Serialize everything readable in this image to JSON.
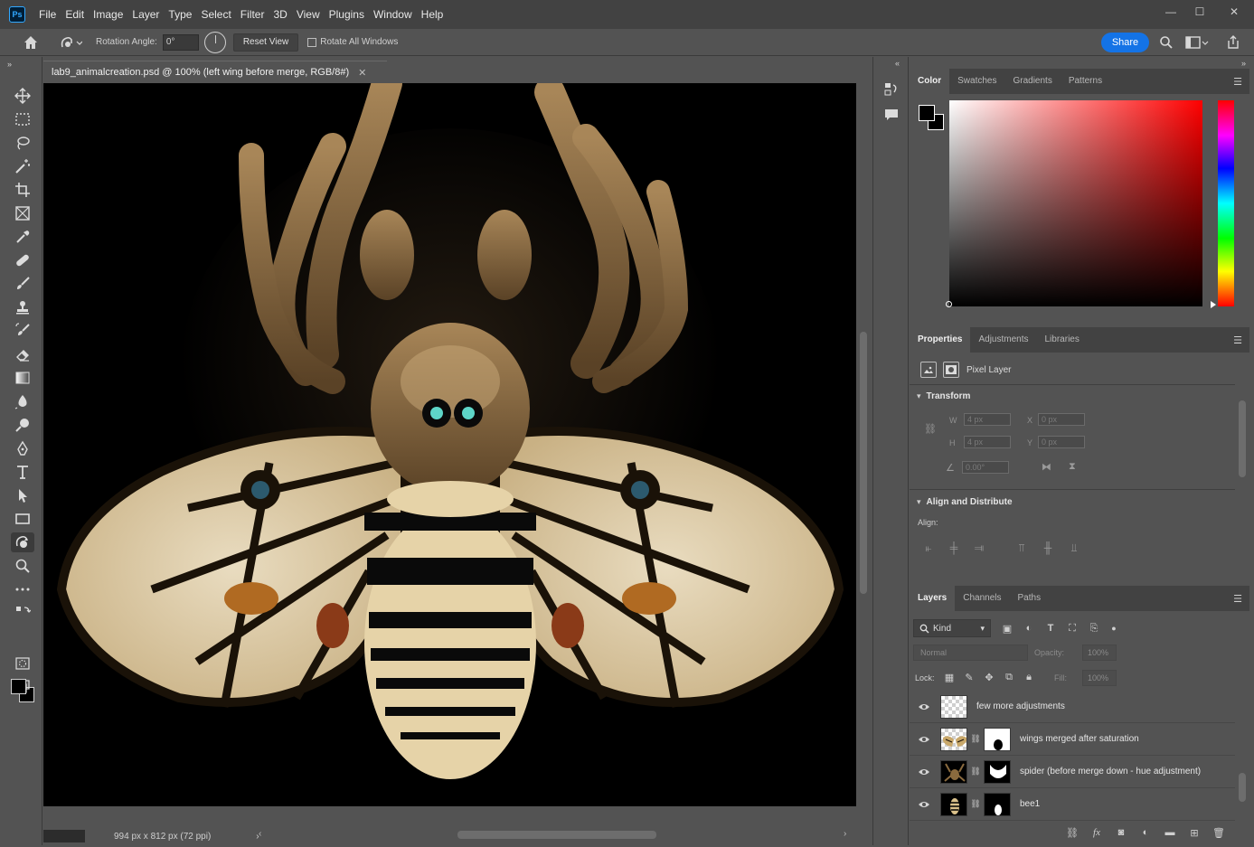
{
  "app": {
    "logo_text": "Ps",
    "menus": [
      "File",
      "Edit",
      "Image",
      "Layer",
      "Type",
      "Select",
      "Filter",
      "3D",
      "View",
      "Plugins",
      "Window",
      "Help"
    ],
    "window_controls": {
      "minimize": "—",
      "maximize": "☐",
      "close": "✕"
    }
  },
  "options_bar": {
    "rotation_label": "Rotation Angle:",
    "rotation_value": "0°",
    "reset_view_label": "Reset View",
    "rotate_all_label": "Rotate All Windows",
    "share_label": "Share"
  },
  "toolbar": {
    "collapse": "»",
    "tools": [
      {
        "name": "move-tool",
        "icon": "move-icon"
      },
      {
        "name": "marquee-tool",
        "icon": "rectangle-marquee-icon"
      },
      {
        "name": "lasso-tool",
        "icon": "lasso-icon"
      },
      {
        "name": "magic-wand-tool",
        "icon": "magic-wand-icon"
      },
      {
        "name": "crop-tool",
        "icon": "crop-icon"
      },
      {
        "name": "frame-tool",
        "icon": "frame-icon"
      },
      {
        "name": "eyedropper-tool",
        "icon": "eyedropper-icon"
      },
      {
        "name": "healing-tool",
        "icon": "bandage-icon"
      },
      {
        "name": "brush-tool",
        "icon": "brush-icon"
      },
      {
        "name": "stamp-tool",
        "icon": "stamp-icon"
      },
      {
        "name": "history-brush-tool",
        "icon": "history-brush-icon"
      },
      {
        "name": "eraser-tool",
        "icon": "eraser-icon"
      },
      {
        "name": "gradient-tool",
        "icon": "gradient-icon"
      },
      {
        "name": "blur-tool",
        "icon": "blur-icon"
      },
      {
        "name": "dodge-tool",
        "icon": "dodge-icon"
      },
      {
        "name": "pen-tool",
        "icon": "pen-icon"
      },
      {
        "name": "type-tool",
        "icon": "type-icon"
      },
      {
        "name": "path-selection-tool",
        "icon": "arrow-icon"
      },
      {
        "name": "rectangle-tool",
        "icon": "rectangle-icon"
      },
      {
        "name": "rotate-view-tool",
        "icon": "rotate-hand-icon"
      },
      {
        "name": "zoom-tool",
        "icon": "zoom-icon"
      },
      {
        "name": "more-tools",
        "icon": "ellipsis-icon"
      }
    ]
  },
  "document": {
    "tab_title": "lab9_animalcreation.psd @ 100% (left wing before merge, RGB/8#)",
    "close": "✕",
    "status": "994 px x 812 px (72 ppi)",
    "status_arrow": "›"
  },
  "panels": {
    "collapse": "»",
    "color_tabs": [
      "Color",
      "Swatches",
      "Gradients",
      "Patterns"
    ],
    "colors": {
      "foreground": "#000000",
      "background": "#000000"
    },
    "properties_tabs": [
      "Properties",
      "Adjustments",
      "Libraries"
    ],
    "properties": {
      "layer_type": "Pixel Layer",
      "transform_title": "Transform",
      "w_label": "W",
      "w_value": "4 px",
      "h_label": "H",
      "h_value": "4 px",
      "x_label": "X",
      "x_value": "0 px",
      "y_label": "Y",
      "y_value": "0 px",
      "angle_value": "0.00°",
      "align_title": "Align and Distribute",
      "align_label": "Align:"
    },
    "layers_tabs": [
      "Layers",
      "Channels",
      "Paths"
    ],
    "layers": {
      "filter_kind": "Kind",
      "blend_mode": "Normal",
      "opacity_label": "Opacity:",
      "opacity_value": "100%",
      "lock_label": "Lock:",
      "fill_label": "Fill:",
      "fill_value": "100%",
      "items": [
        {
          "name": "few more adjustments",
          "thumb": "checker",
          "mask": false
        },
        {
          "name": "wings merged after saturation",
          "thumb": "checker",
          "mask": true
        },
        {
          "name": "spider (before merge down - hue adjustment)",
          "thumb": "dark",
          "mask": true
        },
        {
          "name": "bee1",
          "thumb": "dark",
          "mask": true
        }
      ]
    }
  }
}
